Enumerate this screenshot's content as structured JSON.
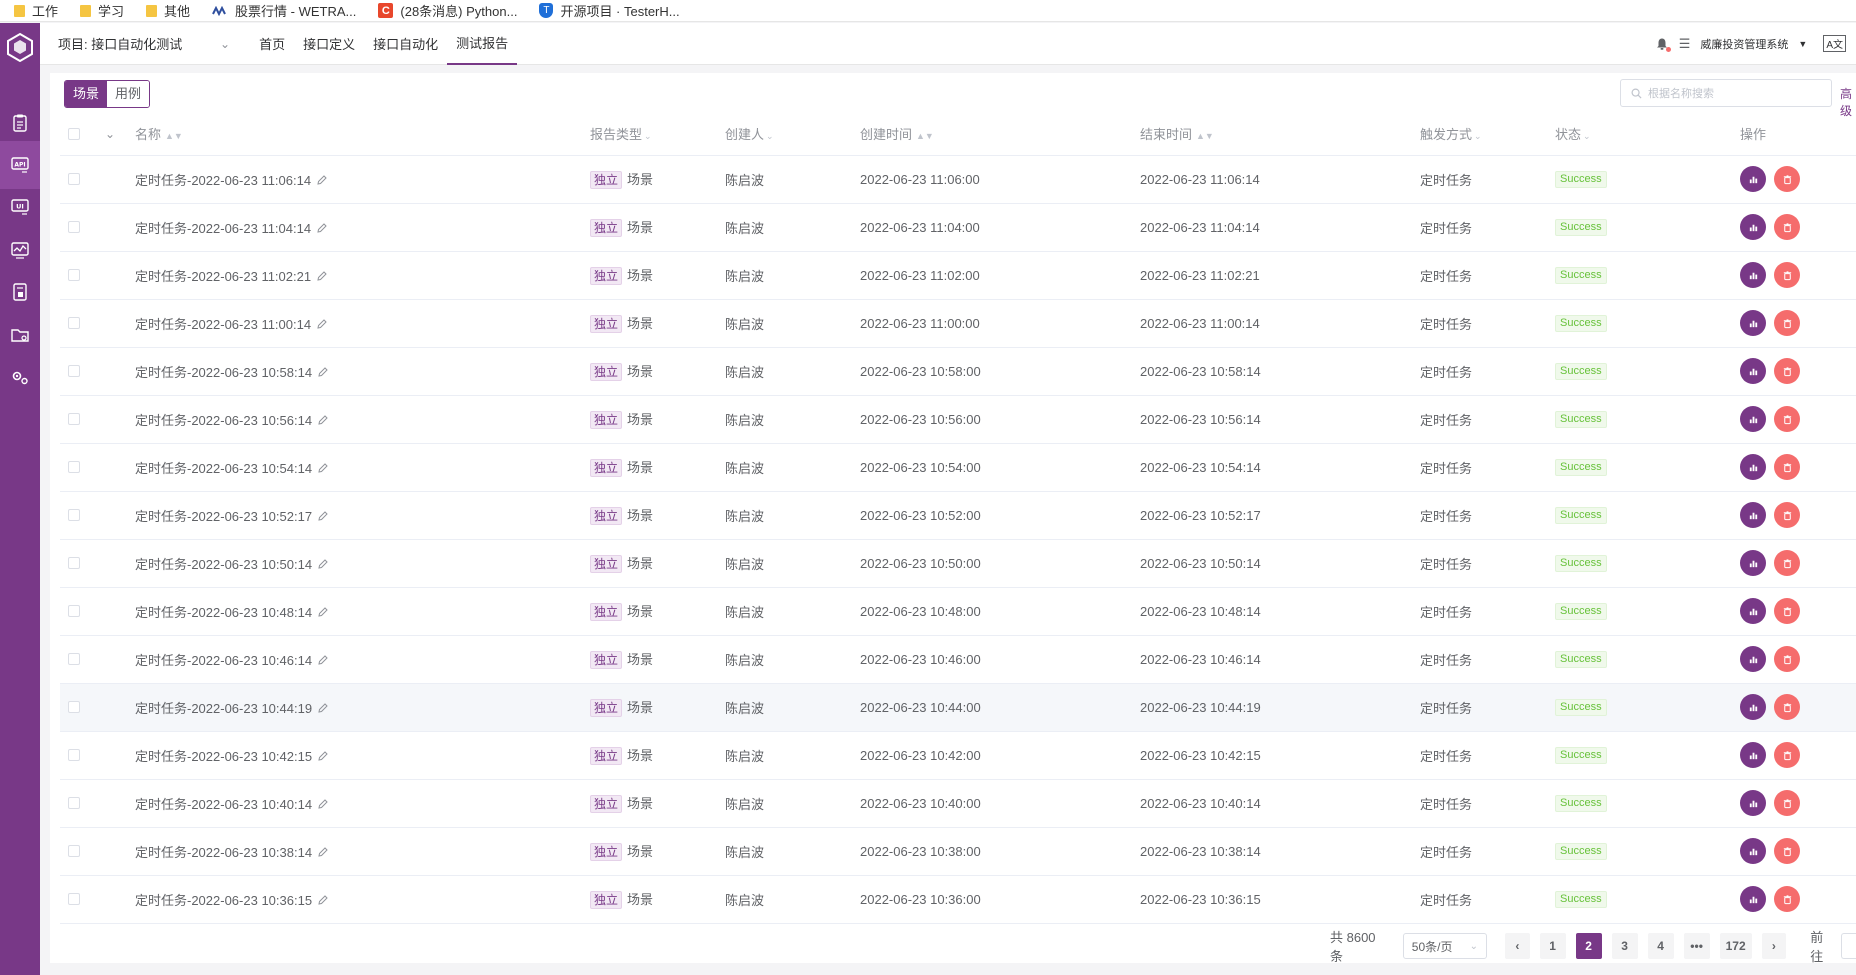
{
  "bookmarks": [
    {
      "label": "工作",
      "icon": "folder-icon"
    },
    {
      "label": "学习",
      "icon": "folder-icon"
    },
    {
      "label": "其他",
      "icon": "folder-icon"
    },
    {
      "label": "股票行情 - WETRA...",
      "icon": "wetrade-icon"
    },
    {
      "label": "(28条消息) Python...",
      "icon": "csdn-icon",
      "glyph": "C"
    },
    {
      "label": "开源项目 · TesterH...",
      "icon": "shield-icon",
      "glyph": "T"
    }
  ],
  "header": {
    "project": "项目: 接口自动化测试",
    "tabs": [
      "首页",
      "接口定义",
      "接口自动化",
      "测试报告"
    ],
    "active_tab": 3,
    "org": "威廉投资管理系统",
    "lang": "A文"
  },
  "toolbar": {
    "seg_scene": "场景",
    "seg_case": "用例",
    "search_placeholder": "根据名称搜索",
    "advanced": "高级"
  },
  "table": {
    "columns": {
      "name": "名称",
      "type": "报告类型",
      "creator": "创建人",
      "created": "创建时间",
      "ended": "结束时间",
      "trigger": "触发方式",
      "status": "状态",
      "ops": "操作"
    },
    "rows": [
      {
        "name": "定时任务-2022-06-23 11:06:14",
        "tag": "独立",
        "type": "场景",
        "creator": "陈启波",
        "created": "2022-06-23 11:06:00",
        "ended": "2022-06-23 11:06:14",
        "trigger": "定时任务",
        "status": "Success"
      },
      {
        "name": "定时任务-2022-06-23 11:04:14",
        "tag": "独立",
        "type": "场景",
        "creator": "陈启波",
        "created": "2022-06-23 11:04:00",
        "ended": "2022-06-23 11:04:14",
        "trigger": "定时任务",
        "status": "Success"
      },
      {
        "name": "定时任务-2022-06-23 11:02:21",
        "tag": "独立",
        "type": "场景",
        "creator": "陈启波",
        "created": "2022-06-23 11:02:00",
        "ended": "2022-06-23 11:02:21",
        "trigger": "定时任务",
        "status": "Success"
      },
      {
        "name": "定时任务-2022-06-23 11:00:14",
        "tag": "独立",
        "type": "场景",
        "creator": "陈启波",
        "created": "2022-06-23 11:00:00",
        "ended": "2022-06-23 11:00:14",
        "trigger": "定时任务",
        "status": "Success"
      },
      {
        "name": "定时任务-2022-06-23 10:58:14",
        "tag": "独立",
        "type": "场景",
        "creator": "陈启波",
        "created": "2022-06-23 10:58:00",
        "ended": "2022-06-23 10:58:14",
        "trigger": "定时任务",
        "status": "Success"
      },
      {
        "name": "定时任务-2022-06-23 10:56:14",
        "tag": "独立",
        "type": "场景",
        "creator": "陈启波",
        "created": "2022-06-23 10:56:00",
        "ended": "2022-06-23 10:56:14",
        "trigger": "定时任务",
        "status": "Success"
      },
      {
        "name": "定时任务-2022-06-23 10:54:14",
        "tag": "独立",
        "type": "场景",
        "creator": "陈启波",
        "created": "2022-06-23 10:54:00",
        "ended": "2022-06-23 10:54:14",
        "trigger": "定时任务",
        "status": "Success"
      },
      {
        "name": "定时任务-2022-06-23 10:52:17",
        "tag": "独立",
        "type": "场景",
        "creator": "陈启波",
        "created": "2022-06-23 10:52:00",
        "ended": "2022-06-23 10:52:17",
        "trigger": "定时任务",
        "status": "Success"
      },
      {
        "name": "定时任务-2022-06-23 10:50:14",
        "tag": "独立",
        "type": "场景",
        "creator": "陈启波",
        "created": "2022-06-23 10:50:00",
        "ended": "2022-06-23 10:50:14",
        "trigger": "定时任务",
        "status": "Success"
      },
      {
        "name": "定时任务-2022-06-23 10:48:14",
        "tag": "独立",
        "type": "场景",
        "creator": "陈启波",
        "created": "2022-06-23 10:48:00",
        "ended": "2022-06-23 10:48:14",
        "trigger": "定时任务",
        "status": "Success"
      },
      {
        "name": "定时任务-2022-06-23 10:46:14",
        "tag": "独立",
        "type": "场景",
        "creator": "陈启波",
        "created": "2022-06-23 10:46:00",
        "ended": "2022-06-23 10:46:14",
        "trigger": "定时任务",
        "status": "Success"
      },
      {
        "name": "定时任务-2022-06-23 10:44:19",
        "tag": "独立",
        "type": "场景",
        "creator": "陈启波",
        "created": "2022-06-23 10:44:00",
        "ended": "2022-06-23 10:44:19",
        "trigger": "定时任务",
        "status": "Success",
        "hover": true
      },
      {
        "name": "定时任务-2022-06-23 10:42:15",
        "tag": "独立",
        "type": "场景",
        "creator": "陈启波",
        "created": "2022-06-23 10:42:00",
        "ended": "2022-06-23 10:42:15",
        "trigger": "定时任务",
        "status": "Success"
      },
      {
        "name": "定时任务-2022-06-23 10:40:14",
        "tag": "独立",
        "type": "场景",
        "creator": "陈启波",
        "created": "2022-06-23 10:40:00",
        "ended": "2022-06-23 10:40:14",
        "trigger": "定时任务",
        "status": "Success"
      },
      {
        "name": "定时任务-2022-06-23 10:38:14",
        "tag": "独立",
        "type": "场景",
        "creator": "陈启波",
        "created": "2022-06-23 10:38:00",
        "ended": "2022-06-23 10:38:14",
        "trigger": "定时任务",
        "status": "Success"
      },
      {
        "name": "定时任务-2022-06-23 10:36:15",
        "tag": "独立",
        "type": "场景",
        "creator": "陈启波",
        "created": "2022-06-23 10:36:00",
        "ended": "2022-06-23 10:36:15",
        "trigger": "定时任务",
        "status": "Success"
      }
    ]
  },
  "pagination": {
    "total": "共 8600 条",
    "page_size": "50条/页",
    "pages": [
      "1",
      "2",
      "3",
      "4",
      "•••",
      "172"
    ],
    "current": "2",
    "goto": "前往"
  },
  "colors": {
    "brand": "#783887",
    "danger": "#f56c6c",
    "success": "#67c23a"
  }
}
